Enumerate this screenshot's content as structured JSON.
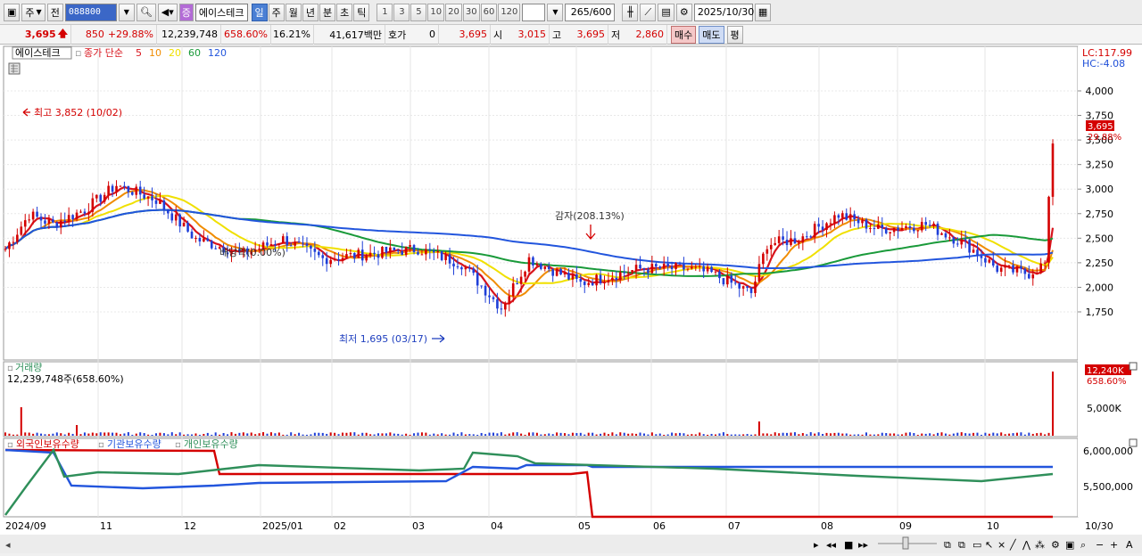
{
  "toolbar": {
    "jong_label": "주",
    "jeon_label": "전",
    "code": "088800",
    "stock_name": "에이스테크",
    "periods": [
      "일",
      "주",
      "월",
      "년",
      "분",
      "초",
      "틱"
    ],
    "selected_period": "일",
    "intervals": [
      "1",
      "3",
      "5",
      "10",
      "20",
      "30",
      "60",
      "120"
    ],
    "count": "265",
    "count_max": "/600",
    "date": "2025/10/30"
  },
  "quote": {
    "price": "3,695",
    "change": "850",
    "change_pct": "+29.88%",
    "volume": "12,239,748",
    "volume_pct": "658.60%",
    "turnover": "16.21%",
    "amount": "41,617백만",
    "hoga_label": "호가",
    "hoga": "0",
    "ask": "3,695",
    "open_label": "시",
    "open": "3,015",
    "high_label": "고",
    "high": "3,695",
    "low_label": "저",
    "low": "2,860",
    "buy_label": "매수",
    "sell_label": "매도",
    "avg_label": "평"
  },
  "main_panel": {
    "title": "에이스테크",
    "legend_prefix": "종가 단순",
    "ma_periods": [
      "5",
      "10",
      "20",
      "60",
      "120"
    ],
    "ma_colors": [
      "#d8141c",
      "#f08c00",
      "#f0e000",
      "#1a9a3a",
      "#2255dd"
    ],
    "lc_label": "LC:117.99",
    "hc_label": "HC:-4.08",
    "yticks": [
      "4,000",
      "3,750",
      "3,500",
      "3,250",
      "3,000",
      "2,750",
      "2,500",
      "2,250",
      "2,000",
      "1,750"
    ],
    "price_tag": "3,695",
    "price_tag_pct": "29.88%",
    "high_note": "최고 3,852 (10/02)",
    "low_note": "최저 1,695 (03/17)",
    "dividend_note": "배당락(0.00%)",
    "capital_note": "감자(208.13%)"
  },
  "volume_panel": {
    "title": "거래량",
    "value_line": "12,239,748주(658.60%)",
    "tag": "12,240K",
    "tag_pct": "658.60%",
    "ytick": "5,000K"
  },
  "holding_panel": {
    "legend": [
      "외국인보유수량",
      "기관보유수량",
      "개인보유수량"
    ],
    "legend_colors": [
      "#d40000",
      "#2255dd",
      "#2f8f5a"
    ],
    "yticks": [
      "6,000,000",
      "5,500,000"
    ]
  },
  "xaxis": {
    "labels": [
      "2024/09",
      "11",
      "12",
      "2025/01",
      "02",
      "03",
      "04",
      "05",
      "06",
      "07",
      "08",
      "09",
      "10"
    ],
    "end_label": "10/30"
  }
}
